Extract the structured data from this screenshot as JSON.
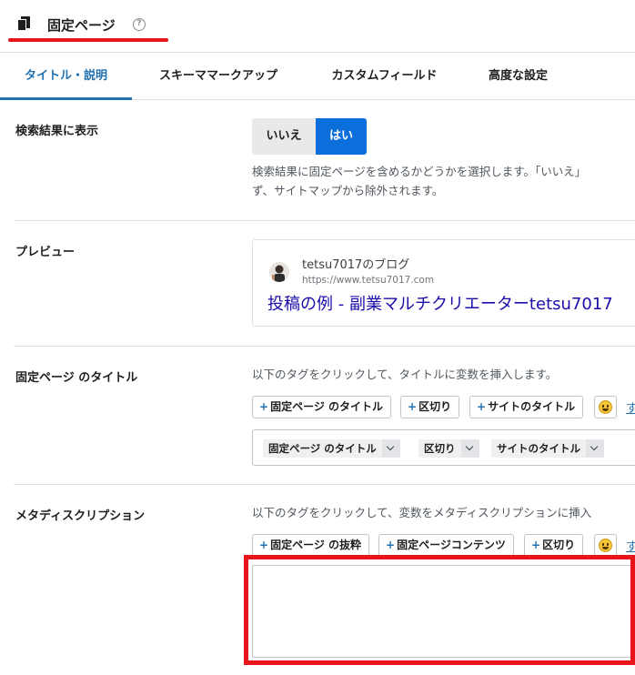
{
  "header": {
    "title": "固定ページ",
    "help_icon": "?"
  },
  "tabs": [
    {
      "label": "タイトル・説明",
      "active": true
    },
    {
      "label": "スキーママークアップ",
      "active": false
    },
    {
      "label": "カスタムフィールド",
      "active": false
    },
    {
      "label": "高度な設定",
      "active": false
    }
  ],
  "search_results": {
    "label": "検索結果に表示",
    "no": "いいえ",
    "yes": "はい",
    "selected": "はい",
    "desc_line1": "検索結果に固定ページを含めるかどうかを選択します。「いいえ」",
    "desc_line2": "ず、サイトマップから除外されます。"
  },
  "preview": {
    "label": "プレビュー",
    "site_name": "tetsu7017のブログ",
    "url": "https://www.tetsu7017.com",
    "title": "投稿の例 - 副業マルチクリエーターtetsu7017"
  },
  "page_title": {
    "label": "固定ページ のタイトル",
    "help": "以下のタグをクリックして、タイトルに変数を挿入します。",
    "tag_buttons": [
      "固定ページ のタイトル",
      "区切り",
      "サイトのタイトル"
    ],
    "more": "す",
    "tokens": [
      "固定ページ のタイトル",
      "区切り",
      "サイトのタイトル"
    ]
  },
  "meta_description": {
    "label": "メタディスクリプション",
    "help": "以下のタグをクリックして、変数をメタディスクリプションに挿入",
    "tag_buttons": [
      "固定ページ の抜粋",
      "固定ページコンテンツ",
      "区切り"
    ],
    "more": "す",
    "value": ""
  },
  "colors": {
    "accent": "#2271b1",
    "toggle_active": "#0a6fdb",
    "highlight": "#e8141b",
    "link": "#1a0dab"
  }
}
